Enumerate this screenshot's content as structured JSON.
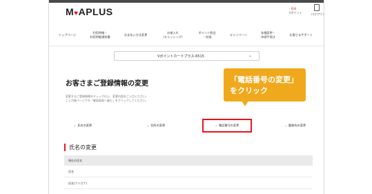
{
  "header": {
    "logo_prefix": "M",
    "logo_heart": "♥",
    "logo_suffix": "APLUS",
    "points_value": "- 834",
    "points_label": "Vポイント",
    "logout_label": "ログアウト"
  },
  "nav": {
    "items": [
      {
        "label": "トップページ"
      },
      {
        "label": "利用明細・\n利用明細通知書"
      },
      {
        "label": "お支払い方法変更"
      },
      {
        "label": "お借入れ\n（キャッシング）"
      },
      {
        "label": "ポイント照会\n・交換"
      },
      {
        "label": "キャンペーン"
      },
      {
        "label": "各種変更・\n申請手続き"
      },
      {
        "label": "お客さまサポート"
      }
    ]
  },
  "card_select": {
    "value": "Vポイントカードプラス-6515",
    "arrow": "⌄"
  },
  "page_title": "お客さまご登録情報の変更",
  "callout": {
    "line1": "「電話番号の変更」",
    "line2": "をクリック"
  },
  "intro": {
    "line1": "変更するご登録情報をチェックの上、変更内容をご入力ください。",
    "line2": "ご入力後ページ下の「確認画面へ進む」をクリックしてください。"
  },
  "tabs": [
    {
      "label": "氏名の変更"
    },
    {
      "label": "住所の変更"
    },
    {
      "label": "電話番号の変更"
    },
    {
      "label": "勤務先の変更"
    }
  ],
  "tab_chevron": "⌄",
  "section": {
    "title": "氏名の変更",
    "row_header": "現在の氏名",
    "rows": [
      {
        "label": "氏名"
      },
      {
        "label": "氏名(フリガナ)"
      }
    ]
  },
  "colors": {
    "accent": "#e5151b",
    "callout": "#f0a91c"
  }
}
